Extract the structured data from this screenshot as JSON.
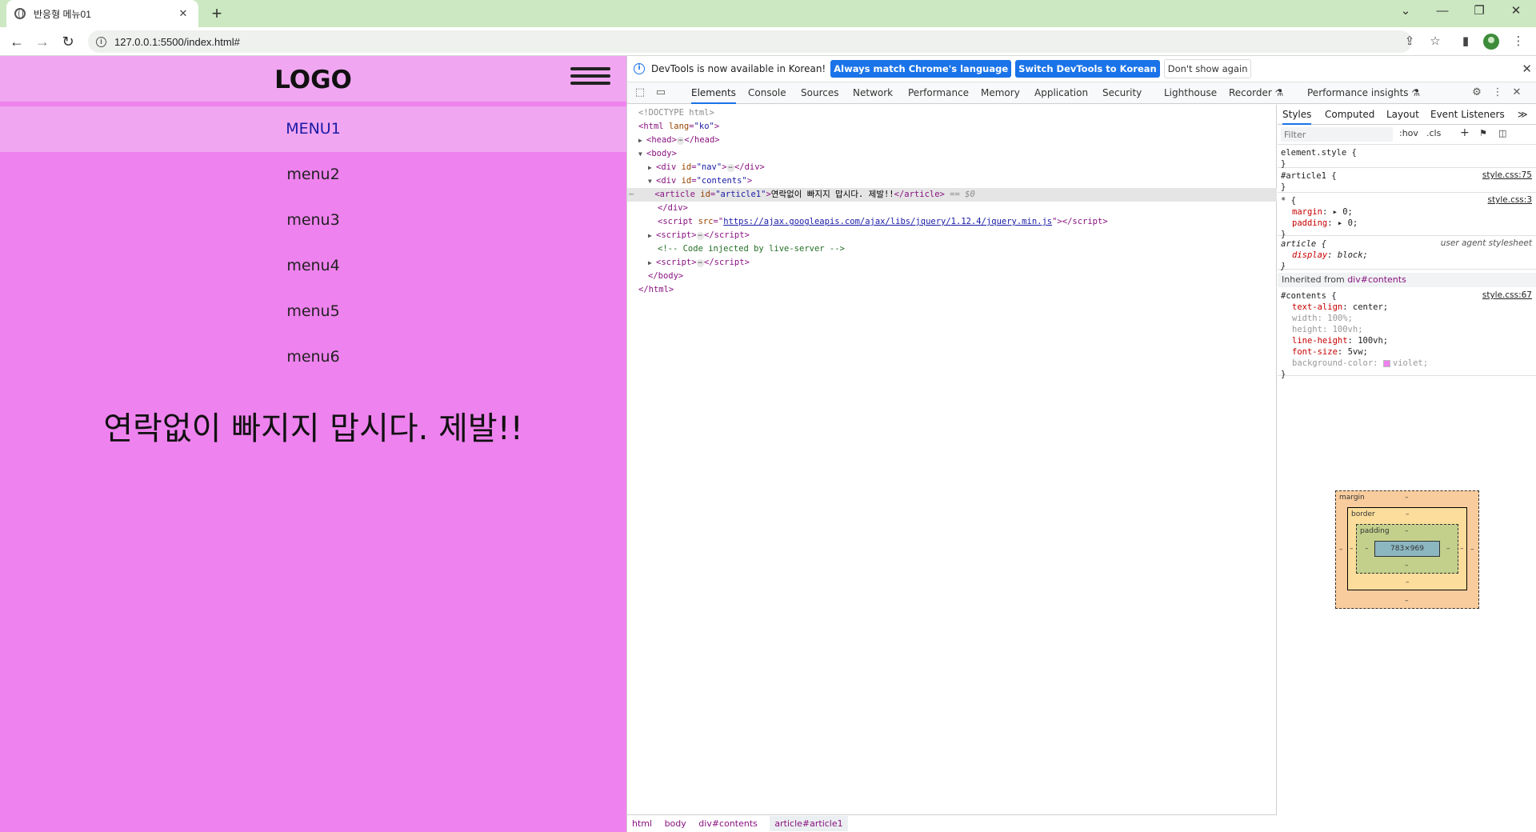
{
  "browser": {
    "tab_title": "반응형 메뉴01",
    "tab_close": "✕",
    "new_tab": "+",
    "url": "127.0.0.1:5500/index.html#",
    "window": {
      "tab_search": "⌄",
      "minimize": "—",
      "restore": "❐",
      "close": "✕"
    },
    "nav": {
      "back": "←",
      "forward": "→",
      "reload": "↻"
    },
    "toolbar": {
      "share": "⇪",
      "bookmark": "☆",
      "sidepanel": "▮",
      "menu": "⋮"
    }
  },
  "page": {
    "logo": "LOGO",
    "menu_items": [
      "MENU1",
      "menu2",
      "menu3",
      "menu4",
      "menu5",
      "menu6"
    ],
    "active_menu_index": 0,
    "article": "연락없이 빠지지 맙시다. 제발!!",
    "background_color": "#ee82ee"
  },
  "devtools": {
    "infobar": {
      "message": "DevTools is now available in Korean!",
      "btn_always": "Always match Chrome's language",
      "btn_switch": "Switch DevTools to Korean",
      "btn_dismiss": "Don't show again",
      "close": "✕"
    },
    "tabs": [
      "Elements",
      "Console",
      "Sources",
      "Network",
      "Performance",
      "Memory",
      "Application",
      "Security",
      "Lighthouse",
      "Recorder ⚗",
      "Performance insights ⚗"
    ],
    "active_tab": "Elements",
    "dom": {
      "doctype": "<!DOCTYPE html>",
      "html_open_tag": "html",
      "html_lang_attr": "lang",
      "html_lang_val": "\"ko\"",
      "head": "head",
      "body": "body",
      "div": "div",
      "id_attr": "id",
      "nav_id": "\"nav\"",
      "contents_id": "\"contents\"",
      "article_tag": "article",
      "article_id": "\"article1\"",
      "article_text": "연락없이 빠지지 맙시다. 제발!!",
      "selected_marker": "== $0",
      "script": "script",
      "src_attr": "src",
      "script_src": "https://ajax.googleapis.com/ajax/libs/jquery/1.12.4/jquery.min.js",
      "comment": "<!-- Code injected by live-server -->",
      "ellipsis": "⋯"
    },
    "breadcrumbs": [
      "html",
      "body",
      "div#contents",
      "article#article1"
    ],
    "styles": {
      "tabs": [
        "Styles",
        "Computed",
        "Layout",
        "Event Listeners",
        "≫"
      ],
      "filter_placeholder": "Filter",
      "hov": ":hov",
      "cls": ".cls",
      "element_style": "element.style {",
      "close_brace": "}",
      "article1_selector": "#article1 {",
      "article1_src": "style.css:75",
      "star_selector": "* {",
      "star_src": "style.css:3",
      "margin_prop": "margin",
      "margin_val": "0;",
      "padding_prop": "padding",
      "padding_val": "0;",
      "article_selector": "article {",
      "ua_label": "user agent stylesheet",
      "display_prop": "display",
      "display_val": "block;",
      "inherited_label": "Inherited from ",
      "inherited_from": "div#contents",
      "contents_selector": "#contents {",
      "contents_src": "style.css:67",
      "contents_props": [
        {
          "name": "text-align",
          "value": "center;",
          "overridden": false
        },
        {
          "name": "width",
          "value": "100%;",
          "overridden": true
        },
        {
          "name": "height",
          "value": "100vh;",
          "overridden": true
        },
        {
          "name": "line-height",
          "value": "100vh;",
          "overridden": false
        },
        {
          "name": "font-size",
          "value": "5vw;",
          "overridden": false
        },
        {
          "name": "background-color",
          "value": "violet;",
          "overridden": true
        }
      ]
    },
    "box_model": {
      "margin_label": "margin",
      "border_label": "border",
      "padding_label": "padding",
      "dash": "–",
      "content_size": "783×969"
    }
  }
}
